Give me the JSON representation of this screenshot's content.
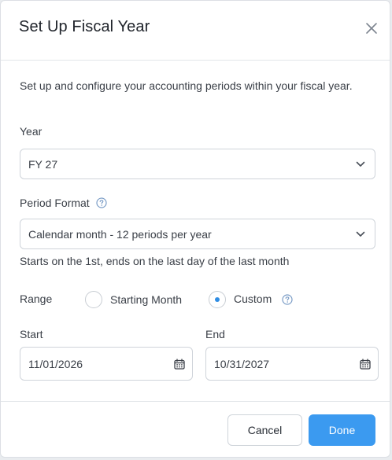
{
  "dialog": {
    "title": "Set Up Fiscal Year",
    "description": "Set up and configure your accounting periods within your fiscal year."
  },
  "year": {
    "label": "Year",
    "value": "FY 27"
  },
  "period_format": {
    "label": "Period Format",
    "value": "Calendar month - 12 periods per year",
    "hint": "Starts on the 1st, ends on the last day of the last month"
  },
  "range": {
    "label": "Range",
    "options": [
      "Starting Month",
      "Custom"
    ],
    "selected": "Custom"
  },
  "start": {
    "label": "Start",
    "value": "11/01/2026"
  },
  "end": {
    "label": "End",
    "value": "10/31/2027"
  },
  "footer": {
    "cancel_label": "Cancel",
    "done_label": "Done"
  },
  "colors": {
    "accent": "#3b9af0",
    "radio_dot": "#2f8de4",
    "border": "#cfd4da",
    "text": "#3a3f47"
  },
  "icons": {
    "close": "close-icon",
    "chevron": "chevron-down-icon",
    "help": "help-circle-icon",
    "calendar": "calendar-icon"
  }
}
